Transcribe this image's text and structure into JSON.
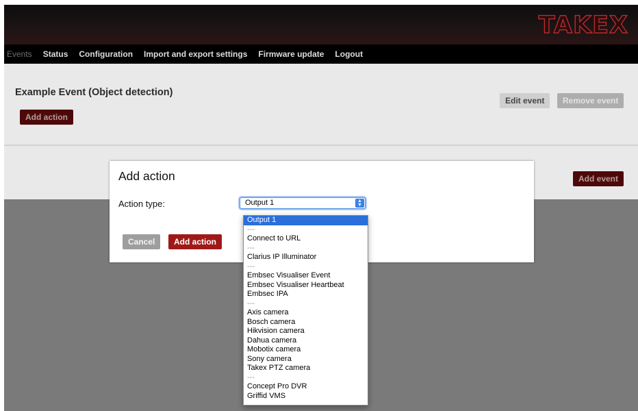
{
  "header": {
    "logo_text": "TAKEX"
  },
  "nav": {
    "items": [
      {
        "label": "Events"
      },
      {
        "label": "Status"
      },
      {
        "label": "Configuration"
      },
      {
        "label": "Import and export settings"
      },
      {
        "label": "Firmware update"
      },
      {
        "label": "Logout"
      }
    ]
  },
  "event": {
    "title": "Example Event (Object detection)",
    "add_action_label": "Add action",
    "edit_label": "Edit event",
    "remove_label": "Remove event"
  },
  "add_event_label": "Add event",
  "modal": {
    "title": "Add action",
    "action_type_label": "Action type:",
    "selected_value": "Output 1",
    "cancel_label": "Cancel",
    "submit_label": "Add action",
    "options": [
      "Output 1",
      "---",
      "Connect to URL",
      "---",
      "Clarius IP Illuminator",
      "---",
      "Embsec Visualiser Event",
      "Embsec Visualiser Heartbeat",
      "Embsec IPA",
      "---",
      "Axis camera",
      "Bosch camera",
      "Hikvision camera",
      "Dahua camera",
      "Mobotix camera",
      "Sony camera",
      "Takex PTZ camera",
      "---",
      "Concept Pro DVR",
      "Griffid VMS"
    ]
  },
  "colors": {
    "accent_red": "#a01919",
    "header_bg": "#1c1414",
    "overlay": "#7a7a7a",
    "dropdown_highlight": "#2a6fdb"
  },
  "icons": {
    "select_arrow": "up-down-chevron-icon"
  }
}
